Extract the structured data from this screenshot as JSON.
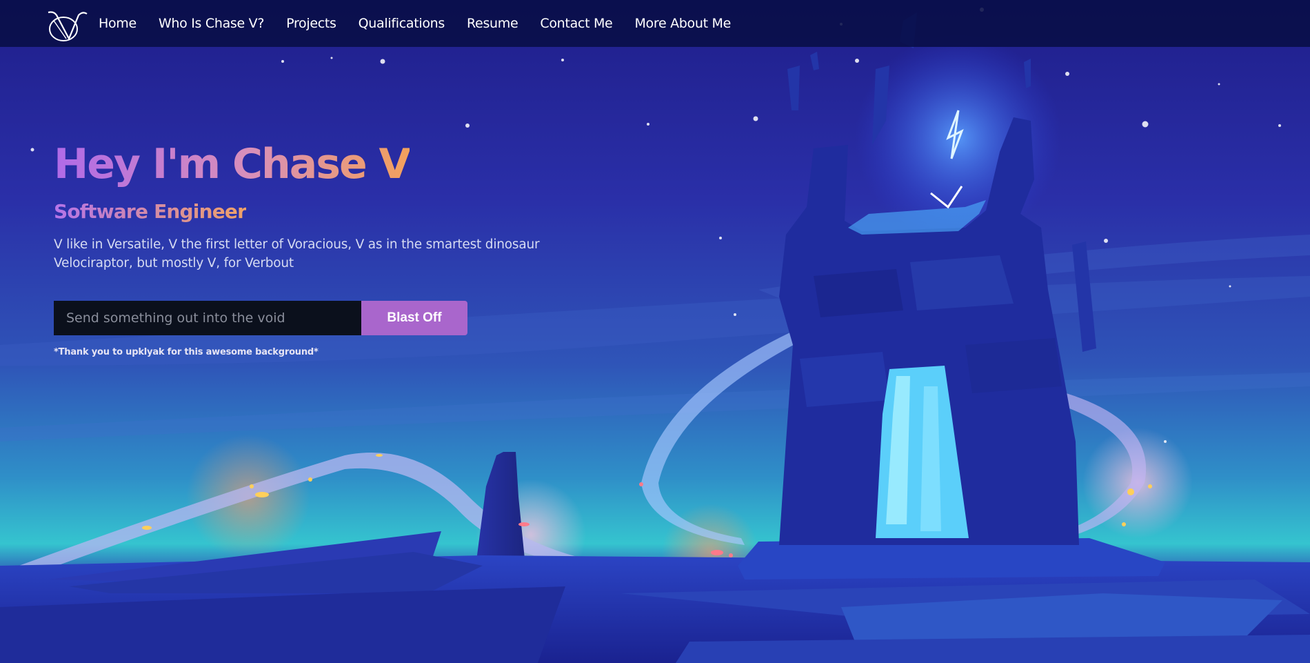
{
  "brand": {
    "logo_icon": "cv-monogram-logo-icon"
  },
  "nav": {
    "items": [
      {
        "label": "Home"
      },
      {
        "label": "Who Is Chase V?"
      },
      {
        "label": "Projects"
      },
      {
        "label": "Qualifications"
      },
      {
        "label": "Resume"
      },
      {
        "label": "Contact Me"
      },
      {
        "label": "More About Me"
      }
    ]
  },
  "hero": {
    "title": "Hey I'm Chase V",
    "subtitle": "Software Engineer",
    "description_line1": "V like in Versatile, V the first letter of Voracious, V as in the smartest dinosaur",
    "description_line2": "Velociraptor, but mostly V, for Verbout"
  },
  "message_form": {
    "placeholder": "Send something out into the void",
    "value": "",
    "submit_label": "Blast Off"
  },
  "credit": {
    "text": "*Thank you to upklyak for this awesome background*"
  },
  "colors": {
    "navbar_bg": "#080e46",
    "title_gradient_start": "#b06ae8",
    "title_gradient_end": "#f3a15c",
    "button_bg": "#a966cc",
    "input_bg": "#0b101c",
    "portal_glow": "#3fd0ff"
  }
}
